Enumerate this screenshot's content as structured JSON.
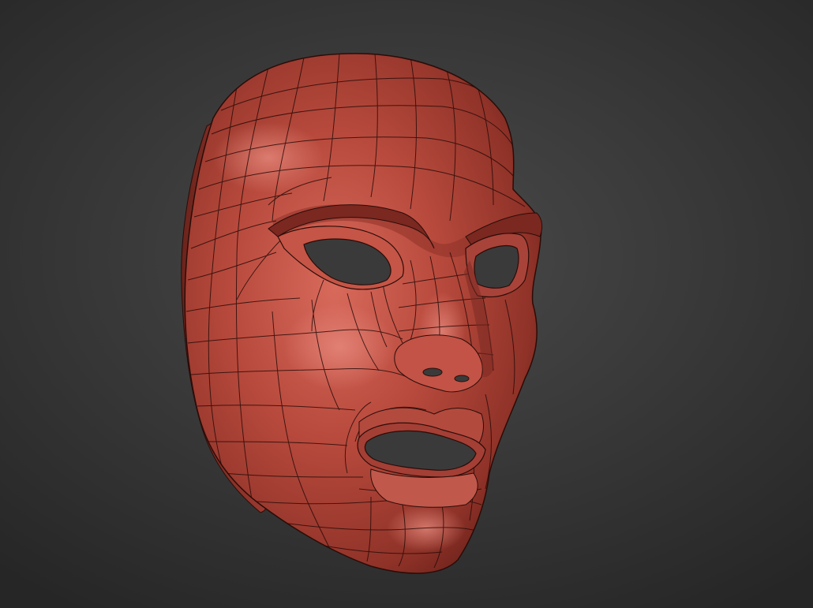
{
  "scene": {
    "subject": "mask-model",
    "background_color": "#3a3a3a",
    "material_color": "#b5483c",
    "wireframe_color": "#2a0c08"
  }
}
